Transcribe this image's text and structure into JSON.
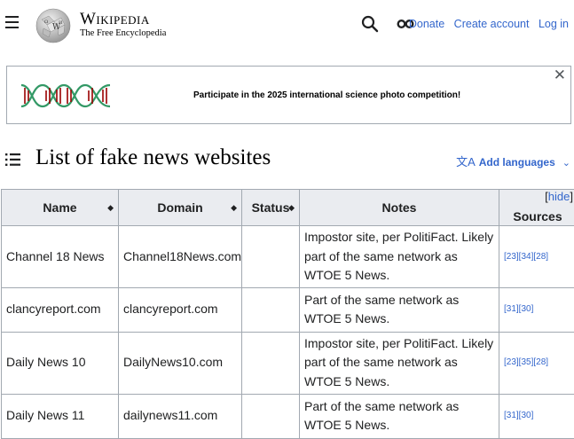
{
  "header": {
    "wordmark_title": "Wikipedia",
    "wordmark_tagline": "The Free Encyclopedia",
    "links": [
      "Donate",
      "Create account",
      "Log in"
    ]
  },
  "banner": {
    "text": "Participate in the 2025 international science photo competition!",
    "close": "✕"
  },
  "page": {
    "title": "List of fake news websites",
    "add_languages": "Add languages",
    "lang_icon": "文A"
  },
  "table": {
    "headers": [
      "Name",
      "Domain",
      "Status",
      "Notes",
      "Sources"
    ],
    "hide_label": "hide",
    "rows": [
      {
        "name": "Channel 18 News",
        "domain": "Channel18News.com",
        "status": "",
        "notes": "Impostor site, per PolitiFact. Likely part of the same network as WTOE 5 News.",
        "sources": "[23][34][28]"
      },
      {
        "name": "clancyreport.com",
        "domain": "clancyreport.com",
        "status": "",
        "notes": "Part of the same network as WTOE 5 News.",
        "sources": "[31][30]"
      },
      {
        "name": "Daily News 10",
        "domain": "DailyNews10.com",
        "status": "",
        "notes": "Impostor site, per PolitiFact. Likely part of the same network as WTOE 5 News.",
        "sources": "[23][35][28]"
      },
      {
        "name": "Daily News 11",
        "domain": "dailynews11.com",
        "status": "",
        "notes": "Part of the same network as WTOE 5 News.",
        "sources": "[31][30]"
      }
    ]
  },
  "colors": {
    "link": "#3366cc",
    "header_bg": "#eaecf0",
    "border": "#a2a9b1",
    "dna_green": "#339966",
    "dna_red": "#990000"
  }
}
